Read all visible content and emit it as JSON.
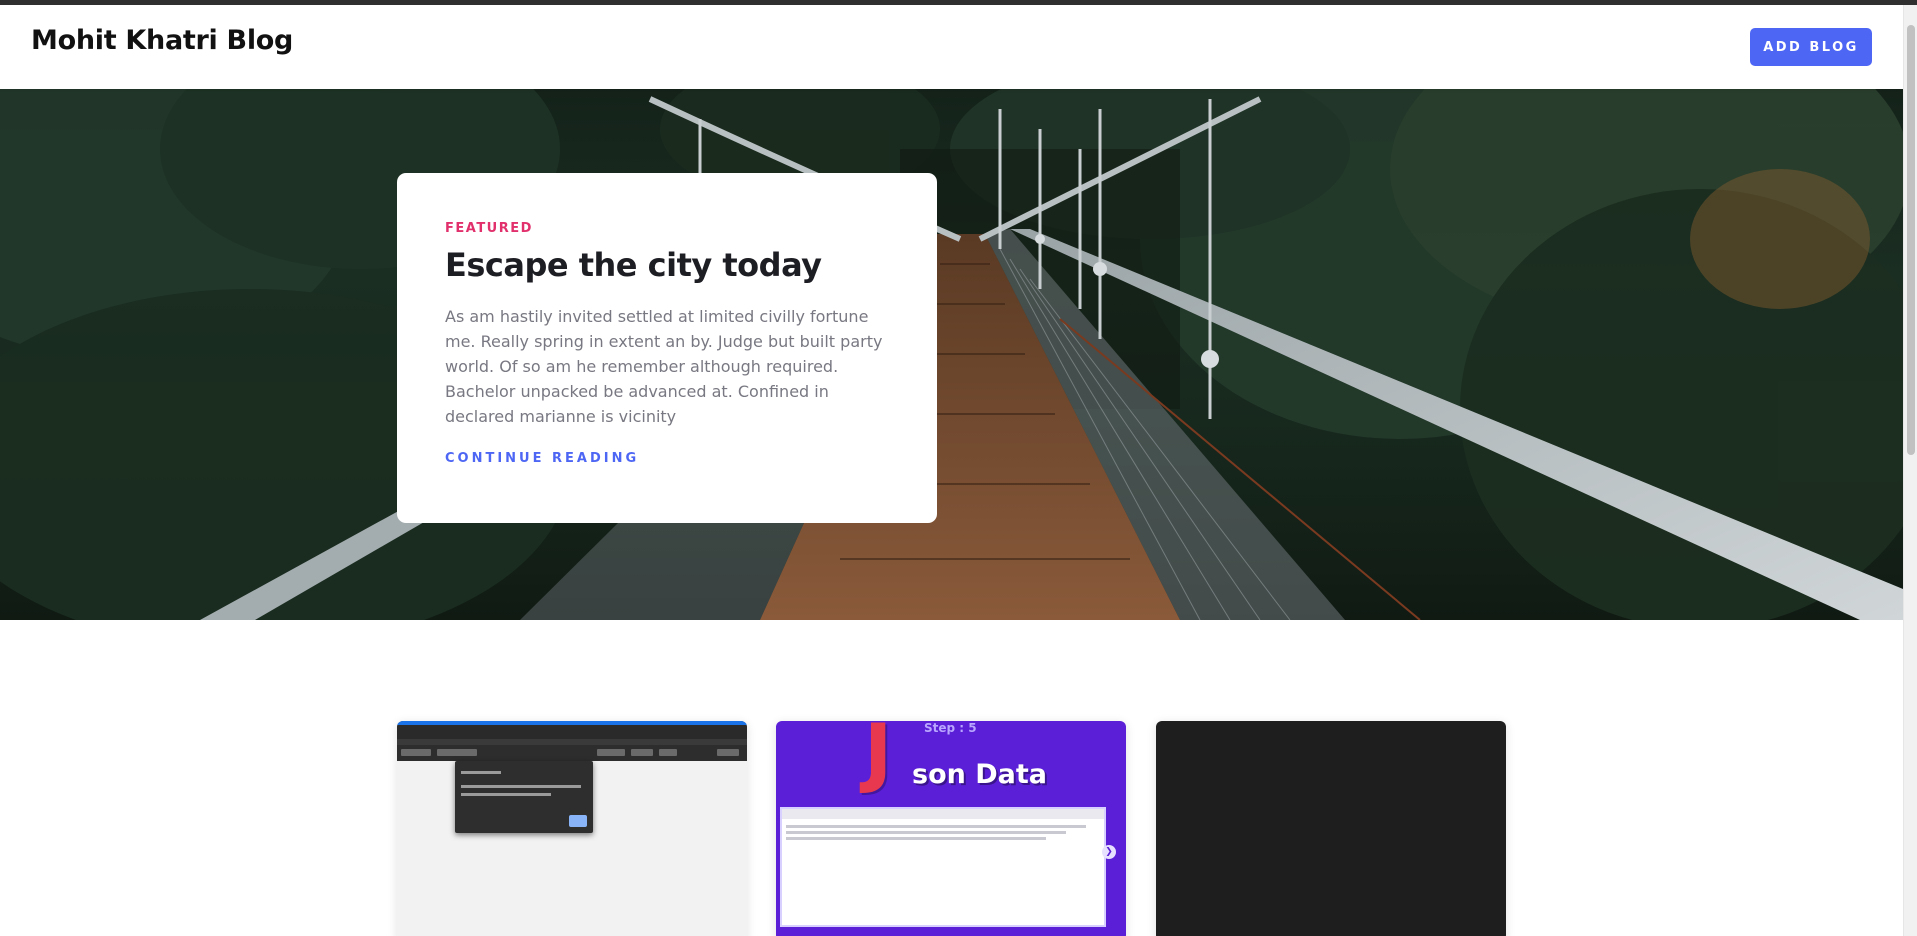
{
  "header": {
    "brand": "Mohit Khatri Blog",
    "add_blog_label": "ADD BLOG"
  },
  "featured": {
    "tag": "FEATURED",
    "title": "Escape the city today",
    "excerpt": "As am hastily invited settled at limited civilly fortune me. Really spring in extent an by. Judge but built party world. Of so am he remember although required. Bachelor unpacked be advanced at. Confined in declared marianne is vicinity",
    "cta": "CONTINUE READING"
  },
  "cards": [
    {
      "kind": "browser-screenshot"
    },
    {
      "kind": "thumbnail",
      "step_label": "Step : 5",
      "big_letter": "J",
      "title_rest": "son Data"
    },
    {
      "kind": "dark-thumbnail"
    }
  ],
  "colors": {
    "accent": "#4e66f4",
    "featured_tag": "#e1306c",
    "title": "#1d1d24",
    "body_text": "#787882",
    "card2_bg": "#5a1fd6",
    "card2_letter": "#e8384f"
  }
}
